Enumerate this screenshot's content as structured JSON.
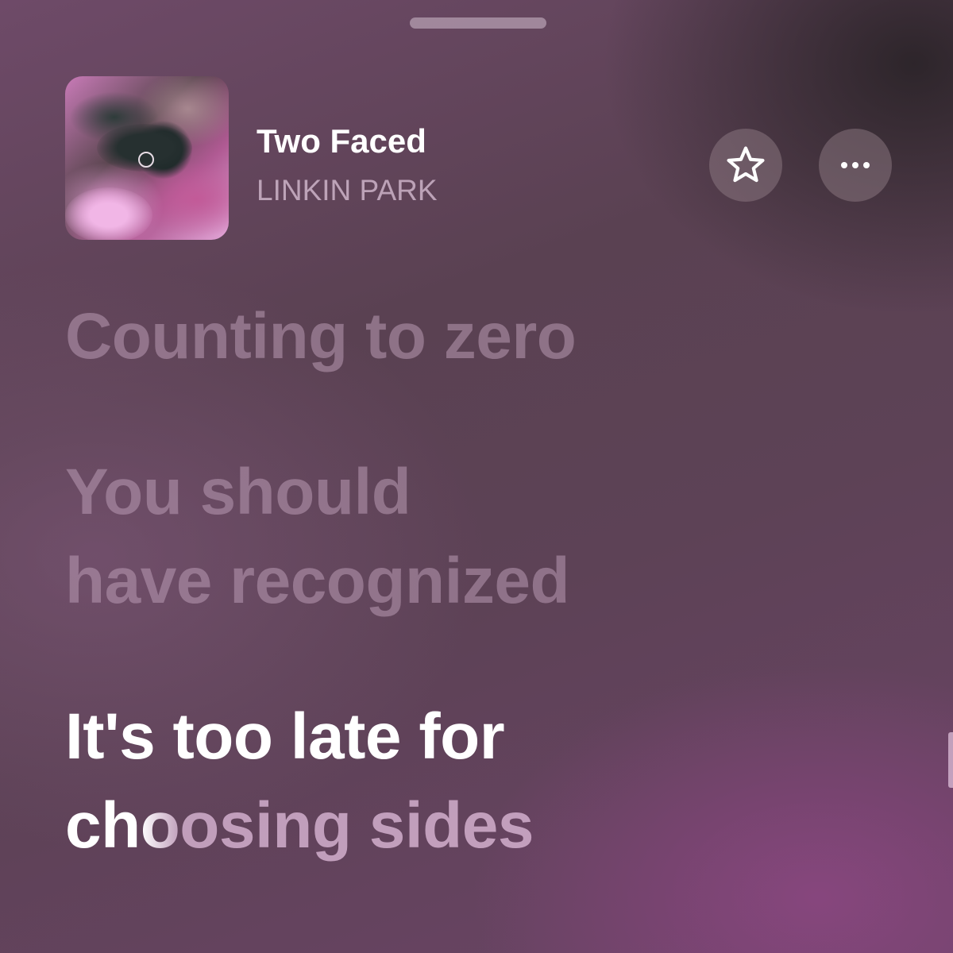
{
  "now_playing": {
    "title": "Two Faced",
    "artist": "LINKIN PARK"
  },
  "actions": {
    "favorite_icon": "star-icon",
    "more_icon": "ellipsis-icon"
  },
  "lyrics": {
    "past": [
      "Counting to zero",
      "You should",
      "have recognized"
    ],
    "current_line_1": "It's too late for",
    "current_line_2_sung": "ch",
    "current_line_2_transition": "o",
    "current_line_2_unsung": "osing sides"
  },
  "colors": {
    "accent_text": "#ffffff",
    "dim_lyric": "#bea0b9"
  }
}
